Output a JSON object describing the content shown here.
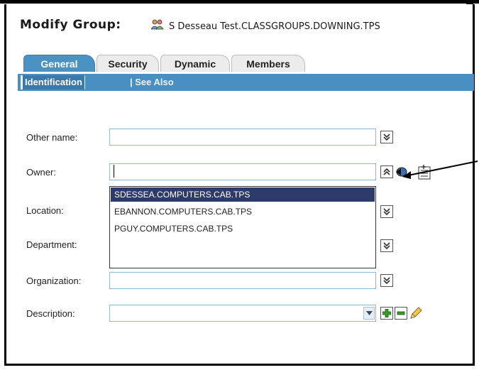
{
  "header": {
    "title": "Modify Group:",
    "object_icon": "group-icon",
    "object_name": "S Desseau Test.CLASSGROUPS.DOWNING.TPS"
  },
  "tabs": [
    {
      "label": "General",
      "active": true
    },
    {
      "label": "Security",
      "active": false
    },
    {
      "label": "Dynamic",
      "active": false
    },
    {
      "label": "Members",
      "active": false
    }
  ],
  "subtabs": {
    "active": "Identification",
    "other": "| See Also"
  },
  "form": {
    "other_name": {
      "label": "Other name:",
      "value": ""
    },
    "owner": {
      "label": "Owner:",
      "value": ""
    },
    "location": {
      "label": "Location:",
      "value": ""
    },
    "department": {
      "label": "Department:",
      "value": ""
    },
    "organization": {
      "label": "Organization:",
      "value": ""
    },
    "description": {
      "label": "Description:",
      "value": ""
    }
  },
  "owner_dropdown": {
    "options": [
      "SDESSEA.COMPUTERS.CAB.TPS",
      "EBANNON.COMPUTERS.CAB.TPS",
      "PGUY.COMPUTERS.CAB.TPS"
    ],
    "selected_index": 0
  },
  "colors": {
    "tab_active": "#4a92c4",
    "tab_bar": "#4a8fc2",
    "dropdown_selected": "#2e3a6a",
    "add_icon": "#3a9a2a"
  }
}
